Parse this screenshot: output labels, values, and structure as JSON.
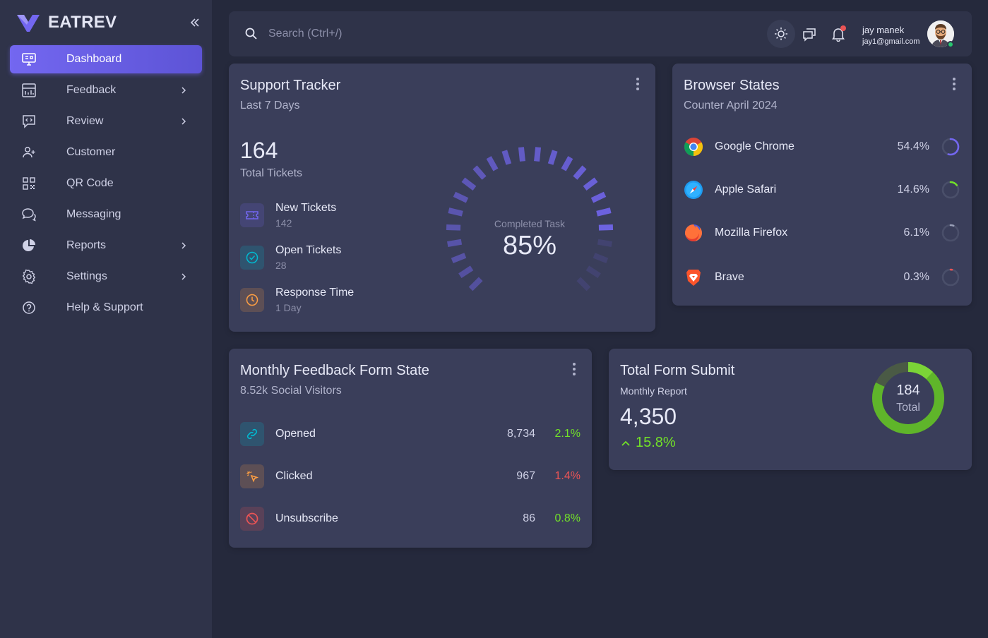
{
  "brand": {
    "name": "EATREV",
    "collapse_icon": "double-chevron-left-icon"
  },
  "sidebar": {
    "items": [
      {
        "label": "Dashboard",
        "icon": "monitor-icon",
        "active": true,
        "has_submenu": false
      },
      {
        "label": "Feedback",
        "icon": "chart-board-icon",
        "active": false,
        "has_submenu": true
      },
      {
        "label": "Review",
        "icon": "code-message-icon",
        "active": false,
        "has_submenu": true
      },
      {
        "label": "Customer",
        "icon": "user-plus-icon",
        "active": false,
        "has_submenu": false
      },
      {
        "label": "QR Code",
        "icon": "qr-code-icon",
        "active": false,
        "has_submenu": false
      },
      {
        "label": "Messaging",
        "icon": "chat-bubbles-icon",
        "active": false,
        "has_submenu": false
      },
      {
        "label": "Reports",
        "icon": "pie-chart-icon",
        "active": false,
        "has_submenu": true
      },
      {
        "label": "Settings",
        "icon": "gear-icon",
        "active": false,
        "has_submenu": true
      },
      {
        "label": "Help & Support",
        "icon": "help-circle-icon",
        "active": false,
        "has_submenu": false
      }
    ]
  },
  "topbar": {
    "search_placeholder": "Search (Ctrl+/)",
    "user_name": "jay manek",
    "user_email": "jay1@gmail.com"
  },
  "support_tracker": {
    "title": "Support Tracker",
    "subtitle": "Last 7 Days",
    "total_value": "164",
    "total_label": "Total Tickets",
    "stats": [
      {
        "title": "New Tickets",
        "value": "142",
        "icon": "ticket-icon",
        "color": "#7367f0"
      },
      {
        "title": "Open Tickets",
        "value": "28",
        "icon": "check-circle-icon",
        "color": "#00bad1"
      },
      {
        "title": "Response Time",
        "value": "1 Day",
        "icon": "clock-icon",
        "color": "#ff9f43"
      }
    ],
    "gauge_label": "Completed Task",
    "gauge_value": "85%",
    "gauge_percent": 85
  },
  "browser_states": {
    "title": "Browser States",
    "subtitle": "Counter April 2024",
    "items": [
      {
        "name": "Google Chrome",
        "percent": "54.4%",
        "value": 54.4,
        "color": "#7367f0",
        "icon": "chrome-icon"
      },
      {
        "name": "Apple Safari",
        "percent": "14.6%",
        "value": 14.6,
        "color": "#72e128",
        "icon": "safari-icon"
      },
      {
        "name": "Mozilla Firefox",
        "percent": "6.1%",
        "value": 6.1,
        "color": "#9aa0b8",
        "icon": "firefox-icon"
      },
      {
        "name": "Brave",
        "percent": "0.3%",
        "value": 0.3,
        "color": "#ea5455",
        "icon": "brave-icon"
      }
    ]
  },
  "monthly_feedback": {
    "title": "Monthly Feedback Form State",
    "subtitle": "8.52k Social Visitors",
    "rows": [
      {
        "name": "Opened",
        "count": "8,734",
        "percent": "2.1%",
        "trend_color": "#72e128",
        "icon": "link-icon",
        "icon_color": "#00bad1"
      },
      {
        "name": "Clicked",
        "count": "967",
        "percent": "1.4%",
        "trend_color": "#ea5455",
        "icon": "cursor-click-icon",
        "icon_color": "#ff9f43"
      },
      {
        "name": "Unsubscribe",
        "count": "86",
        "percent": "0.8%",
        "trend_color": "#72e128",
        "icon": "ban-icon",
        "icon_color": "#ea5455"
      }
    ]
  },
  "form_submit": {
    "title": "Total Form Submit",
    "subtitle": "Monthly Report",
    "value": "4,350",
    "growth": "15.8%",
    "donut_value": "184",
    "donut_label": "Total",
    "donut_percent": 82
  }
}
